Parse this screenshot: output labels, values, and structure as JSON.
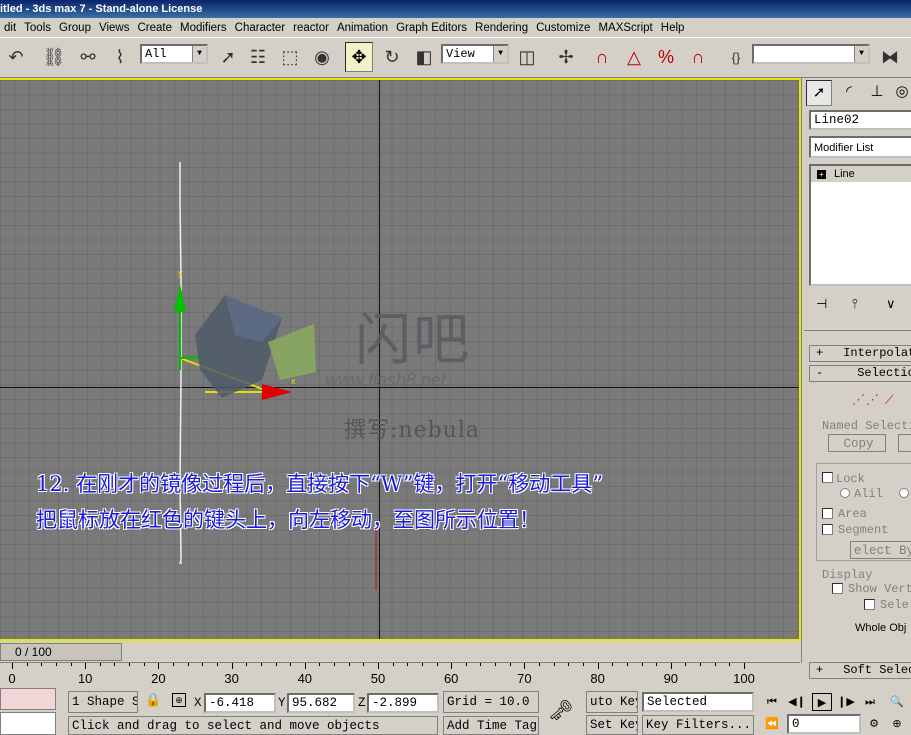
{
  "titlebar": {
    "title": "itled - 3ds max 7  - Stand-alone License"
  },
  "menu": [
    "dit",
    "Tools",
    "Group",
    "Views",
    "Create",
    "Modifiers",
    "Character",
    "reactor",
    "Animation",
    "Graph Editors",
    "Rendering",
    "Customize",
    "MAXScript",
    "Help"
  ],
  "toolbar": {
    "filter_value": "All",
    "refcoord_value": "View"
  },
  "viewport": {
    "watermark_main": "闪吧",
    "watermark_url": "www.flash8.net",
    "watermark_author": "撰写:nebula",
    "caption_line1": "12. 在刚才的镜像过程后，直接按下“W”键，打开“移动工具”",
    "caption_line2": "把鼠标放在红色的键头上，向左移动，至图所示位置！",
    "gizmo_x": "x",
    "gizmo_y": "y"
  },
  "command_panel": {
    "object_name": "Line02",
    "modifier_list": "Modifier List",
    "stack_item": "Line",
    "rollouts": {
      "interpolation": "Interpolat",
      "selection": "Selectio",
      "soft_selection": "Soft Selec"
    },
    "named_selection": "Named Selecti",
    "copy_button": "Copy",
    "lock_label": "Lock",
    "all_label": "Alil",
    "area_label": "Area",
    "segment_label": "Segment",
    "select_by": "elect By",
    "display_label": "Display",
    "show_vertex": "Show Vert",
    "select_sub": "Sele",
    "whole_object": "Whole Obj"
  },
  "timeline": {
    "position": "0 / 100",
    "ticks": [
      "0",
      "10",
      "20",
      "30",
      "40",
      "50",
      "60",
      "70",
      "80",
      "90",
      "100"
    ]
  },
  "status": {
    "selection_count": "1 Shape S",
    "x_label": "X:",
    "x_value": "-6.418",
    "y_label": "Y:",
    "y_value": "95.682",
    "z_label": "Z:",
    "z_value": "-2.899",
    "grid": "Grid = 10.0",
    "prompt": "Click and drag to select and move objects",
    "add_time_tag": "Add Time Tag",
    "auto_key": "uto Key",
    "set_key": "Set Key",
    "selected": "Selected",
    "key_filters": "Key Filters...",
    "frame": "0"
  }
}
